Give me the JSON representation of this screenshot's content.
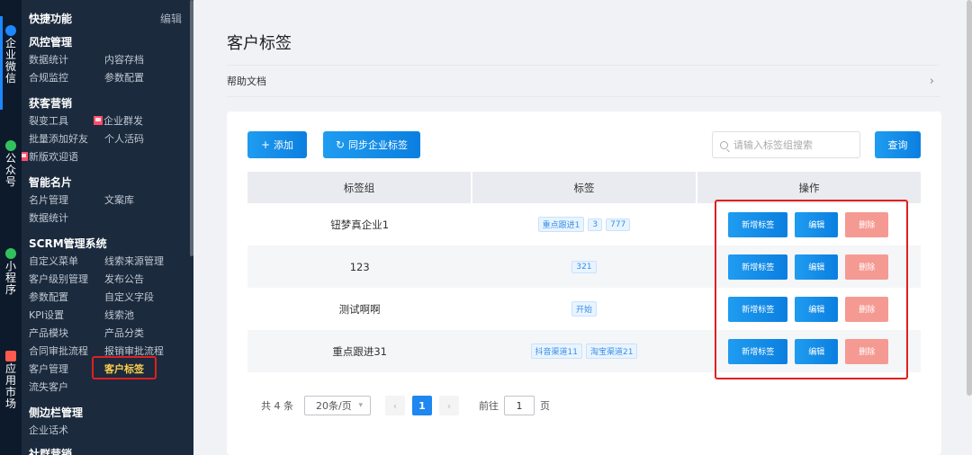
{
  "rail": {
    "items": [
      {
        "label": "企业微信",
        "icon_color": "#1e87ff"
      },
      {
        "label": "公众号",
        "icon_color": "#32c25d"
      },
      {
        "label": "小程序",
        "icon_color": "#32c25d"
      },
      {
        "label": "应用市场",
        "icon_color": "#ff5a4e"
      }
    ]
  },
  "menu": {
    "quick_title": "快捷功能",
    "edit_label": "编辑",
    "groups": [
      {
        "title": "风控管理",
        "items": [
          "数据统计",
          "内容存档",
          "合规监控",
          "参数配置"
        ]
      },
      {
        "title": "获客营销",
        "items": [
          "裂变工具",
          "企业群发",
          "批量添加好友",
          "个人活码",
          "新版欢迎语"
        ]
      },
      {
        "title": "智能名片",
        "items": [
          "名片管理",
          "文案库",
          "数据统计"
        ]
      },
      {
        "title": "SCRM管理系统",
        "items": [
          "自定义菜单",
          "线索来源管理",
          "客户级别管理",
          "发布公告",
          "参数配置",
          "自定义字段",
          "KPI设置",
          "线索池",
          "产品模块",
          "产品分类",
          "合同审批流程",
          "报销审批流程",
          "客户管理",
          "客户标签",
          "流失客户"
        ]
      },
      {
        "title": "侧边栏管理",
        "items": [
          "企业话术"
        ]
      },
      {
        "title": "社群营销",
        "items": []
      }
    ]
  },
  "page": {
    "title": "客户标签",
    "help_label": "帮助文档",
    "help_chevron": "›"
  },
  "toolbar": {
    "add_label": "添加",
    "add_icon": "+",
    "sync_label": "同步企业标签",
    "sync_icon": "↻",
    "search_placeholder": "请输入标签组搜索",
    "query_label": "查询"
  },
  "table": {
    "headers": [
      "标签组",
      "标签",
      "操作"
    ],
    "rows": [
      {
        "group": "钮梦真企业1",
        "tags": [
          "重点跟进1",
          "3",
          "777"
        ]
      },
      {
        "group": "123",
        "tags": [
          "321"
        ]
      },
      {
        "group": "测试啊啊",
        "tags": [
          "开始"
        ]
      },
      {
        "group": "重点跟进31",
        "tags": [
          "抖音渠道11",
          "淘宝渠道21"
        ]
      }
    ],
    "actions": {
      "add_tag": "新增标签",
      "edit": "编辑",
      "delete": "删除"
    }
  },
  "pagination": {
    "total_label": "共 4 条",
    "page_size": "20条/页",
    "prev": "‹",
    "current_page": "1",
    "next": "›",
    "goto_label": "前往",
    "goto_value": "1",
    "page_suffix": "页"
  }
}
